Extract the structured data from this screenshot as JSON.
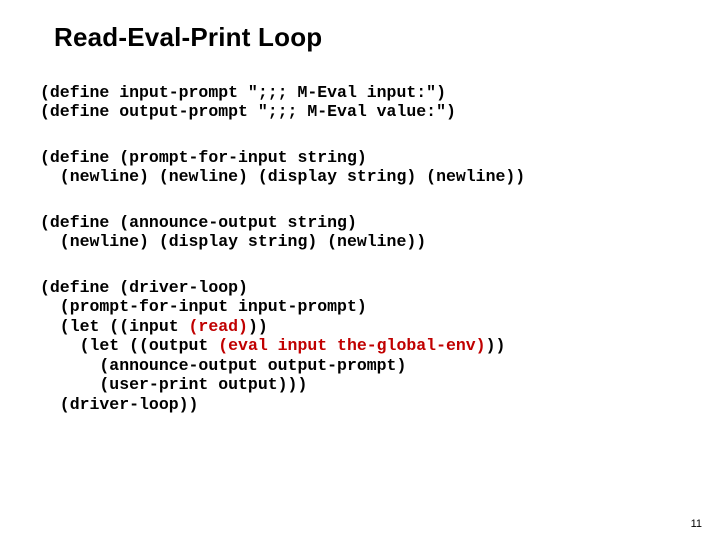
{
  "title": "Read-Eval-Print Loop",
  "page_number": "11",
  "blocks": {
    "b1": {
      "l1": "(define input-prompt \";;; M-Eval input:\")",
      "l2": "(define output-prompt \";;; M-Eval value:\")"
    },
    "b2": {
      "l1": "(define (prompt-for-input string)",
      "l2": "  (newline) (newline) (display string) (newline))"
    },
    "b3": {
      "l1": "(define (announce-output string)",
      "l2": "  (newline) (display string) (newline))"
    },
    "b4": {
      "l1": "(define (driver-loop)",
      "l2": "  (prompt-for-input input-prompt)",
      "l3a": "  (let ((input ",
      "l3b": "(read)",
      "l3c": "))",
      "l4a": "    (let ((output ",
      "l4b": "(eval input the-global-env)",
      "l4c": "))",
      "l5": "      (announce-output output-prompt)",
      "l6": "      (user-print output)))",
      "l7": "  (driver-loop))"
    }
  }
}
